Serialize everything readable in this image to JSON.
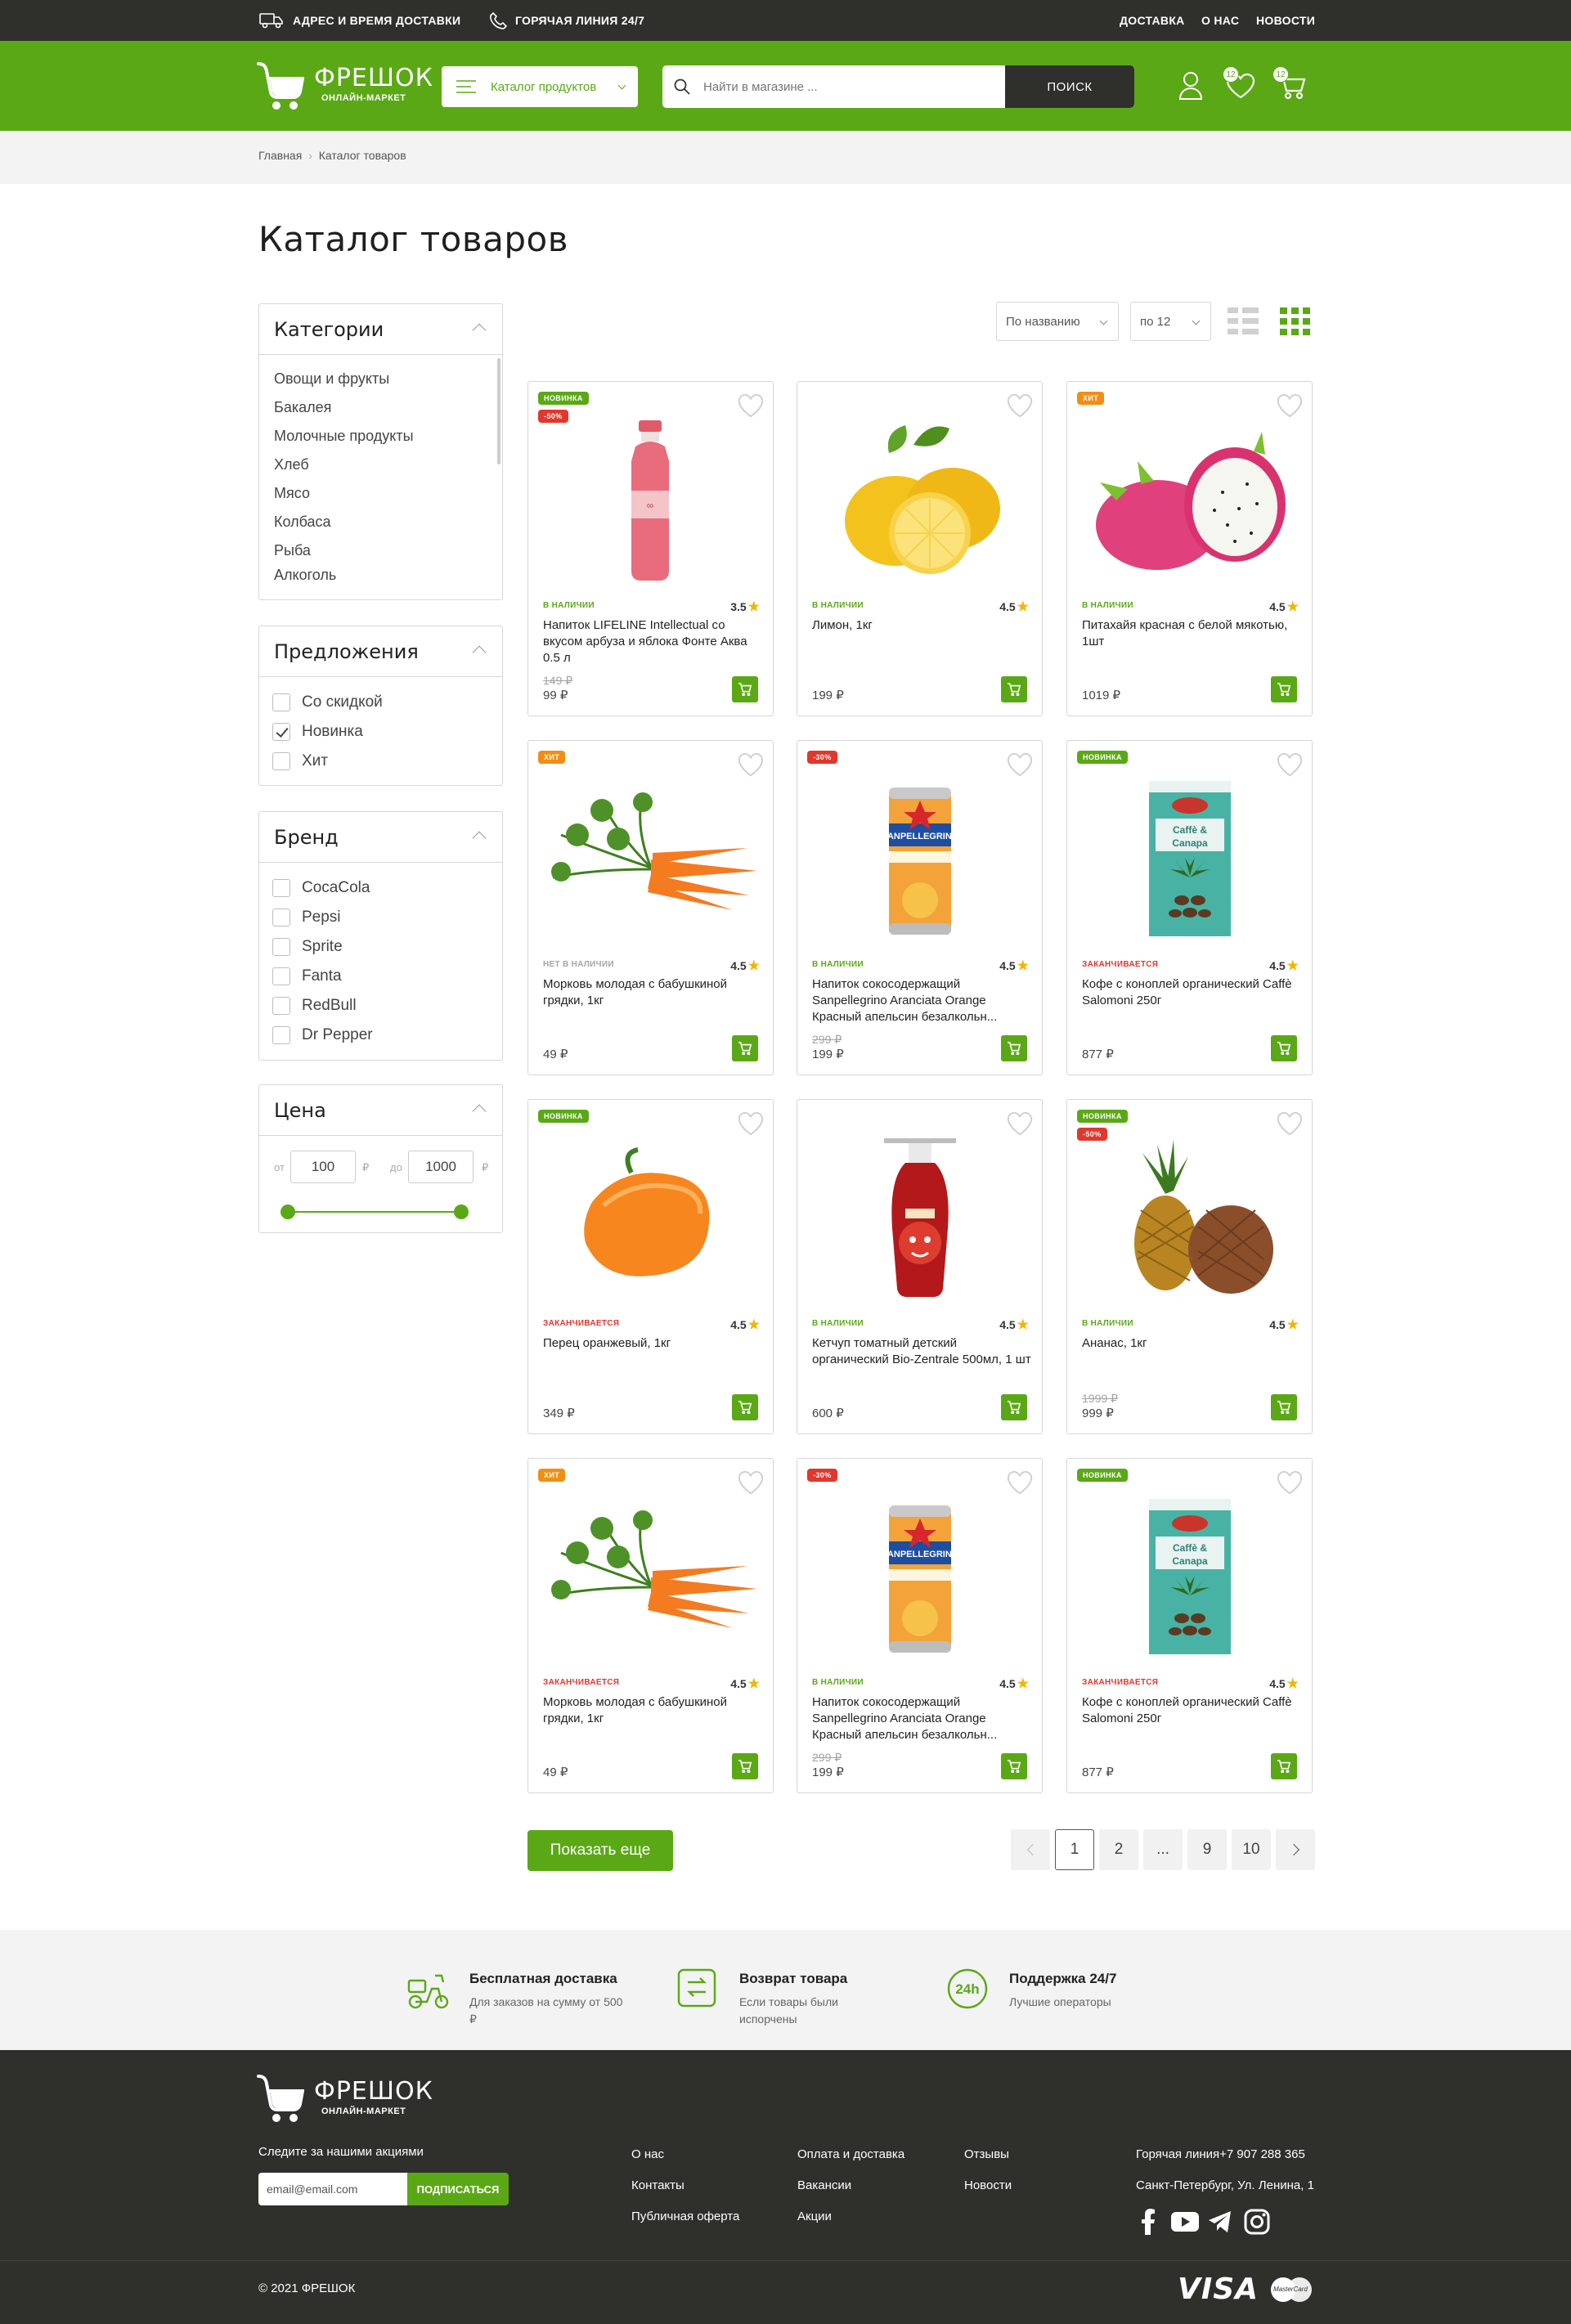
{
  "topbar": {
    "delivery": "АДРЕС И ВРЕМЯ ДОСТАВКИ",
    "hotline": "ГОРЯЧАЯ ЛИНИЯ 24/7",
    "nav": [
      "ДОСТАВКА",
      "О НАС",
      "НОВОСТИ"
    ]
  },
  "header": {
    "logo_title": "ФРЕШОК",
    "logo_sub": "ОНЛАЙН-МАРКЕТ",
    "catalog_btn": "Каталог продуктов",
    "search_placeholder": "Найти в магазине ...",
    "search_btn": "ПОИСК",
    "wishlist_count": "12",
    "cart_count": "12"
  },
  "breadcrumb": {
    "home": "Главная",
    "sep": "›",
    "current": "Каталог товаров"
  },
  "page_title": "Каталог товаров",
  "sidebar": {
    "categories": {
      "title": "Категории",
      "items": [
        "Овощи и фрукты",
        "Бакалея",
        "Молочные продукты",
        "Хлеб",
        "Мясо",
        "Колбаса",
        "Рыба",
        "Алкоголь"
      ]
    },
    "offers": {
      "title": "Предложения",
      "items": [
        {
          "label": "Со скидкой",
          "checked": false
        },
        {
          "label": "Новинка",
          "checked": true
        },
        {
          "label": "Хит",
          "checked": false
        }
      ]
    },
    "brand": {
      "title": "Бренд",
      "items": [
        "CocaCola",
        "Pepsi",
        "Sprite",
        "Fanta",
        "RedBull",
        "Dr Pepper"
      ]
    },
    "price": {
      "title": "Цена",
      "from_label": "от",
      "to_label": "до",
      "currency": "₽",
      "from": "100",
      "to": "1000"
    }
  },
  "sort": {
    "by": "По названию",
    "per_page": "по 12"
  },
  "products": [
    {
      "tags": [
        "НОВИНКА",
        "-50%"
      ],
      "stock": "В НАЛИЧИИ",
      "rating": "3.5",
      "name": "Напиток LIFELINE Intellectual со вкусом арбуза и яблока Фонте Аква 0.5 л",
      "old": "149 ₽",
      "price": "99 ₽",
      "img": "bottle-pink"
    },
    {
      "tags": [],
      "stock": "В НАЛИЧИИ",
      "rating": "4.5",
      "name": "Лимон, 1кг",
      "old": "",
      "price": "199 ₽",
      "img": "lemon"
    },
    {
      "tags": [
        "ХИТ"
      ],
      "stock": "В НАЛИЧИИ",
      "rating": "4.5",
      "name": "Питахайя красная с белой мякотью, 1шт",
      "old": "",
      "price": "1019 ₽",
      "img": "pitaya"
    },
    {
      "tags": [
        "ХИТ"
      ],
      "stock": "НЕТ В НАЛИЧИИ",
      "rating": "4.5",
      "name": "Морковь молодая с бабушкиной грядки, 1кг",
      "old": "",
      "price": "49 ₽",
      "img": "carrot"
    },
    {
      "tags": [
        "-30%"
      ],
      "stock": "В НАЛИЧИИ",
      "rating": "4.5",
      "name": "Напиток сокосодержащий Sanpellegrino Aranciata Orange Красный апельсин безалкольн...",
      "old": "299 ₽",
      "price": "199 ₽",
      "img": "can"
    },
    {
      "tags": [
        "НОВИНКА"
      ],
      "stock": "ЗАКАНЧИВАЕТСЯ",
      "rating": "4.5",
      "name": "Кофе с коноплей органический Caffè Salomoni 250г",
      "old": "",
      "price": "877 ₽",
      "img": "coffee"
    },
    {
      "tags": [
        "НОВИНКА"
      ],
      "stock": "ЗАКАНЧИВАЕТСЯ",
      "rating": "4.5",
      "name": "Перец оранжевый, 1кг",
      "old": "",
      "price": "349 ₽",
      "img": "pepper"
    },
    {
      "tags": [],
      "stock": "В НАЛИЧИИ",
      "rating": "4.5",
      "name": "Кетчуп томатный детский органический Bio-Zentrale 500мл, 1 шт",
      "old": "",
      "price": "600 ₽",
      "img": "ketchup"
    },
    {
      "tags": [
        "НОВИНКА",
        "-50%"
      ],
      "stock": "В НАЛИЧИИ",
      "rating": "4.5",
      "name": "Ананас, 1кг",
      "old": "1999 ₽",
      "price": "999 ₽",
      "img": "pineapple"
    },
    {
      "tags": [
        "ХИТ"
      ],
      "stock": "ЗАКАНЧИВАЕТСЯ",
      "rating": "4.5",
      "name": "Морковь молодая с бабушкиной грядки, 1кг",
      "old": "",
      "price": "49 ₽",
      "img": "carrot"
    },
    {
      "tags": [
        "-30%"
      ],
      "stock": "В НАЛИЧИИ",
      "rating": "4.5",
      "name": "Напиток сокосодержащий Sanpellegrino Aranciata Orange Красный апельсин безалкольн...",
      "old": "299 ₽",
      "price": "199 ₽",
      "img": "can"
    },
    {
      "tags": [
        "НОВИНКА"
      ],
      "stock": "ЗАКАНЧИВАЕТСЯ",
      "rating": "4.5",
      "name": "Кофе с коноплей органический Caffè Salomoni 250г",
      "old": "",
      "price": "877 ₽",
      "img": "coffee"
    }
  ],
  "load_more": "Показать еще",
  "pagination": [
    "1",
    "2",
    "...",
    "9",
    "10"
  ],
  "features": [
    {
      "title": "Бесплатная доставка",
      "desc": "Для заказов на сумму от 500 ₽"
    },
    {
      "title": "Возврат товара",
      "desc": "Если товары были испорчены"
    },
    {
      "title": "Поддержка 24/7",
      "desc": "Лучшие операторы"
    }
  ],
  "footer": {
    "follow": "Следите за нашими акциями",
    "email_placeholder": "email@email.com",
    "subscribe": "ПОДПИСАТЬСЯ",
    "col1": [
      "О нас",
      "Контакты",
      "Публичная оферта"
    ],
    "col2": [
      "Оплата и доставка",
      "Вакансии",
      "Акции"
    ],
    "col3": [
      "Отзывы",
      "Новости"
    ],
    "phone": "Горячая линия+7 907 288 365",
    "address": "Санкт-Петербург, Ул. Ленина, 1",
    "copyright": "© 2021 ФРЕШОК",
    "visa": "VISA",
    "mastercard": "MasterCard"
  },
  "colors": {
    "brand_green": "#5ba816",
    "dark": "#2f302c",
    "sale_red": "#e2372d",
    "hit_orange": "#f28e12"
  }
}
